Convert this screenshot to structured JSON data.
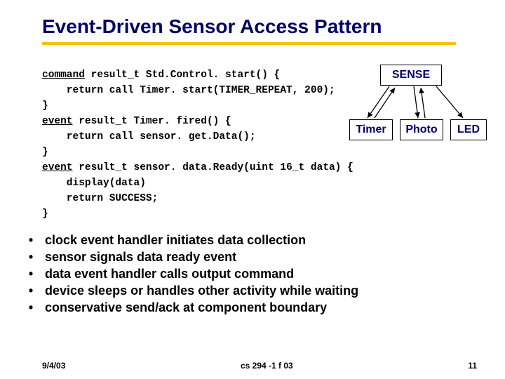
{
  "title": "Event-Driven Sensor Access Pattern",
  "code": {
    "l1_kw": "command",
    "l1_rest": " result_t Std.Control. start() {",
    "l2": "    return call Timer. start(TIMER_REPEAT, 200);",
    "l3": "}",
    "l4_kw": "event",
    "l4_rest": " result_t Timer. fired() {",
    "l5": "    return call sensor. get.Data();",
    "l6": "}",
    "l7_kw": "event",
    "l7_rest": " result_t sensor. data.Ready(uint 16_t data) {",
    "l8": "    display(data)",
    "l9": "    return SUCCESS;",
    "l10": "}"
  },
  "boxes": {
    "sense": "SENSE",
    "timer": "Timer",
    "photo": "Photo",
    "led": "LED"
  },
  "bullets": [
    "clock event handler initiates data collection",
    "sensor signals data ready event",
    "data event handler calls output command",
    "device sleeps or handles other activity while waiting",
    "conservative send/ack at component boundary"
  ],
  "footer": {
    "left": "9/4/03",
    "center": "cs 294 -1 f 03",
    "right": "11"
  }
}
